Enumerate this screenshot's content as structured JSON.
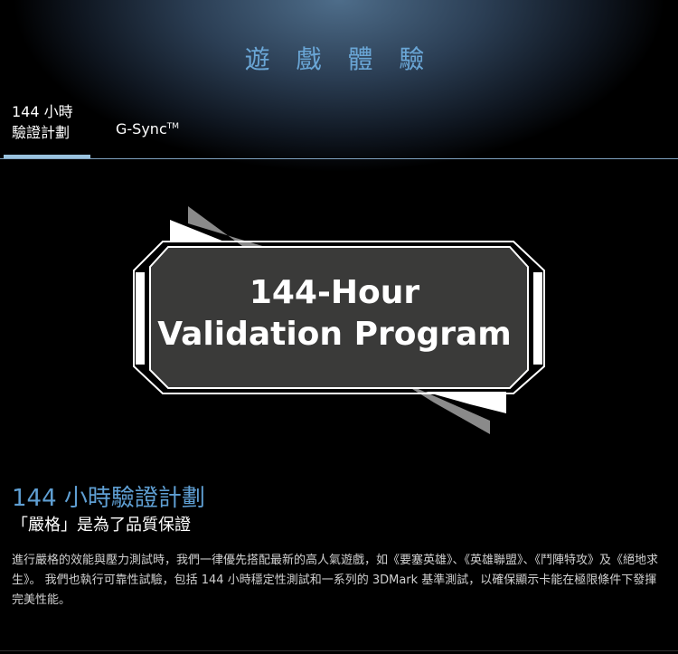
{
  "page": {
    "title": "遊 戲 體 驗"
  },
  "tabs": [
    {
      "label": "144 小時驗證計劃",
      "active": true
    },
    {
      "label": "G-Sync",
      "trademark": "TM",
      "active": false
    }
  ],
  "badge": {
    "line1": "144-Hour",
    "line2": "Validation Program"
  },
  "section": {
    "heading": "144 小時驗證計劃",
    "subheading": "「嚴格」是為了品質保證",
    "body": "進行嚴格的效能與壓力測試時，我們一律優先搭配最新的高人氣遊戲，如《要塞英雄》、《英雄聯盟》、《鬥陣特攻》及《絕地求生》。 我們也執行可靠性試驗，包括 144 小時穩定性測試和一系列的 3DMark 基準測試，以確保顯示卡能在極限條件下發揮完美性能。"
  },
  "colors": {
    "title": "#6aa6d6",
    "heading": "#5f9fd3",
    "active_tab_bar": "#9ac3df",
    "background": "#000000",
    "badge_fill": "#3a3a39"
  },
  "icons": {
    "badge": "validation-badge-icon"
  }
}
